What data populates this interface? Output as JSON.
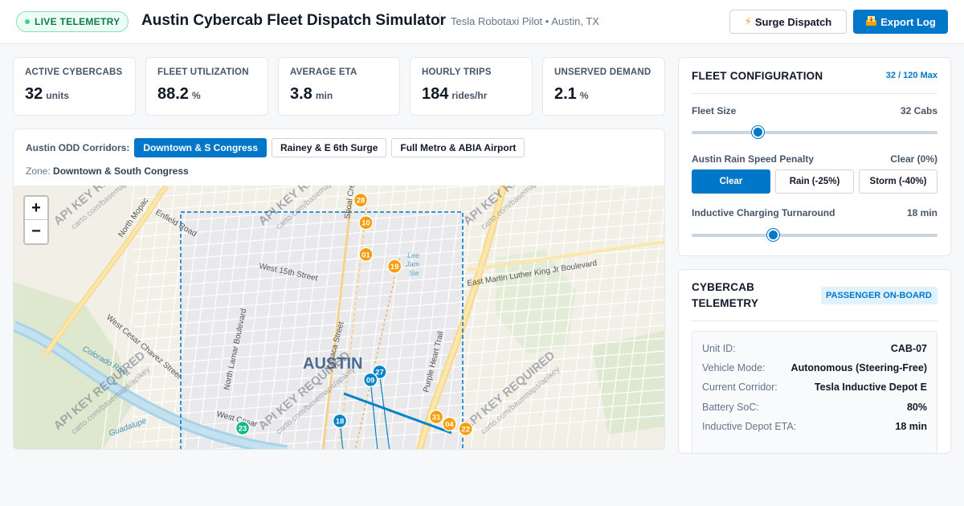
{
  "header": {
    "live_badge": "LIVE TELEMETRY",
    "title": "Austin Cybercab Fleet Dispatch Simulator",
    "subtitle": "Tesla Robotaxi Pilot • Austin, TX",
    "surge_button": "Surge Dispatch",
    "export_button": "Export Log"
  },
  "metrics": [
    {
      "label": "ACTIVE CYBERCABS",
      "value": "32",
      "unit": "units"
    },
    {
      "label": "FLEET UTILIZATION",
      "value": "88.2",
      "unit": "%"
    },
    {
      "label": "AVERAGE ETA",
      "value": "3.8",
      "unit": "min"
    },
    {
      "label": "HOURLY TRIPS",
      "value": "184",
      "unit": "rides/hr"
    },
    {
      "label": "UNSERVED DEMAND",
      "value": "2.1",
      "unit": "%"
    }
  ],
  "corridors": {
    "label": "Austin ODD Corridors:",
    "options": [
      "Downtown & S Congress",
      "Rainey & E 6th Surge",
      "Full Metro & ABIA Airport"
    ],
    "zone_label": "Zone:",
    "zone_value": "Downtown & South Congress"
  },
  "map": {
    "zoom_in": "+",
    "zoom_out": "−",
    "city_label": "AUSTIN",
    "watermark": "API KEY REQUIRED",
    "watermark_sub": "carto.com/basemaps/apikey",
    "streets": [
      "North Mopac",
      "Enfield Road",
      "West 15th Street",
      "East Martin Luther King Jr Boulevard",
      "North Lamar Boulevard",
      "Lavaca Street",
      "Purple Heart Trail",
      "West Cesar",
      "Colorado River",
      "West Cesar Chavez Street",
      "Shoal Creek",
      "Guadalupe",
      "Lee Jamail Swim Center",
      "Colorado Avenue",
      "Congress Avenue"
    ],
    "markers": [
      {
        "id": "28",
        "x": 0.532,
        "y": 0.055,
        "status": "charging"
      },
      {
        "id": "10",
        "x": 0.54,
        "y": 0.14,
        "status": "charging"
      },
      {
        "id": "01",
        "x": 0.54,
        "y": 0.26,
        "status": "charging"
      },
      {
        "id": "19",
        "x": 0.584,
        "y": 0.305,
        "status": "charging"
      },
      {
        "id": "27",
        "x": 0.561,
        "y": 0.703,
        "status": "onboard"
      },
      {
        "id": "09",
        "x": 0.547,
        "y": 0.733,
        "status": "onboard"
      },
      {
        "id": "18",
        "x": 0.5,
        "y": 0.888,
        "status": "onboard"
      },
      {
        "id": "31",
        "x": 0.648,
        "y": 0.873,
        "status": "charging"
      },
      {
        "id": "04",
        "x": 0.668,
        "y": 0.9,
        "status": "charging"
      },
      {
        "id": "22",
        "x": 0.693,
        "y": 0.918,
        "status": "charging"
      },
      {
        "id": "23",
        "x": 0.351,
        "y": 0.915,
        "status": "idle"
      }
    ],
    "colors": {
      "charging": "#f59e0b",
      "onboard": "#0284c7",
      "idle": "#10b981",
      "odd": "#0077c8"
    }
  },
  "fleet_config": {
    "title": "FLEET CONFIGURATION",
    "badge": "32 / 120 Max",
    "fleet_size_label": "Fleet Size",
    "fleet_size_value": "32 Cabs",
    "fleet_size_fraction": 0.267,
    "rain_label": "Austin Rain Speed Penalty",
    "rain_value": "Clear (0%)",
    "rain_options": [
      "Clear",
      "Rain (-25%)",
      "Storm (-40%)"
    ],
    "charging_label": "Inductive Charging Turnaround",
    "charging_value": "18 min",
    "charging_fraction": 0.33
  },
  "telemetry": {
    "title": "CYBERCAB TELEMETRY",
    "status": "PASSENGER ON-BOARD",
    "rows": [
      {
        "key": "Unit ID:",
        "value": "CAB-07"
      },
      {
        "key": "Vehicle Mode:",
        "value": "Autonomous (Steering-Free)"
      },
      {
        "key": "Current Corridor:",
        "value": "Tesla Inductive Depot E"
      },
      {
        "key": "Battery SoC:",
        "value": "80%"
      },
      {
        "key": "Inductive Depot ETA:",
        "value": "18 min"
      }
    ]
  }
}
